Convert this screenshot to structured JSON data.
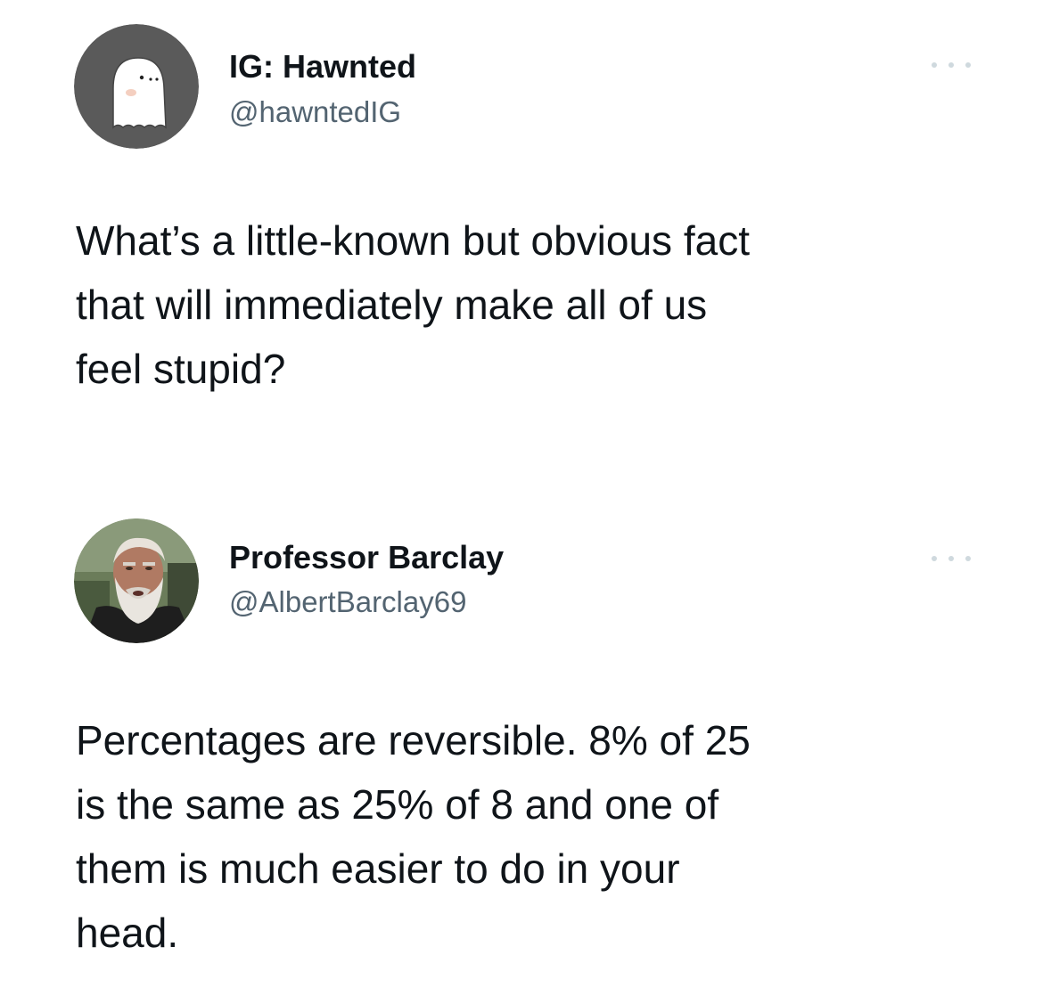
{
  "tweets": [
    {
      "display_name": "IG: Hawnted",
      "handle": "@hawntedIG",
      "avatar_icon": "ghost-avatar",
      "more_icon": "ellipsis-icon",
      "text": "What’s a little-known but obvious fact\nthat will immediately make all of us\nfeel stupid?"
    },
    {
      "display_name": "Professor Barclay",
      "handle": "@AlbertBarclay69",
      "avatar_icon": "bearded-man-avatar",
      "more_icon": "ellipsis-icon",
      "text": "Percentages are reversible.  8% of 25\nis the same as 25% of 8 and one of\nthem is much easier to do in your\nhead."
    }
  ],
  "colors": {
    "text": "#0f1419",
    "secondary": "#536471",
    "ghost_avatar_bg": "#5a5a5a",
    "more_dots": "#cfd9de"
  }
}
